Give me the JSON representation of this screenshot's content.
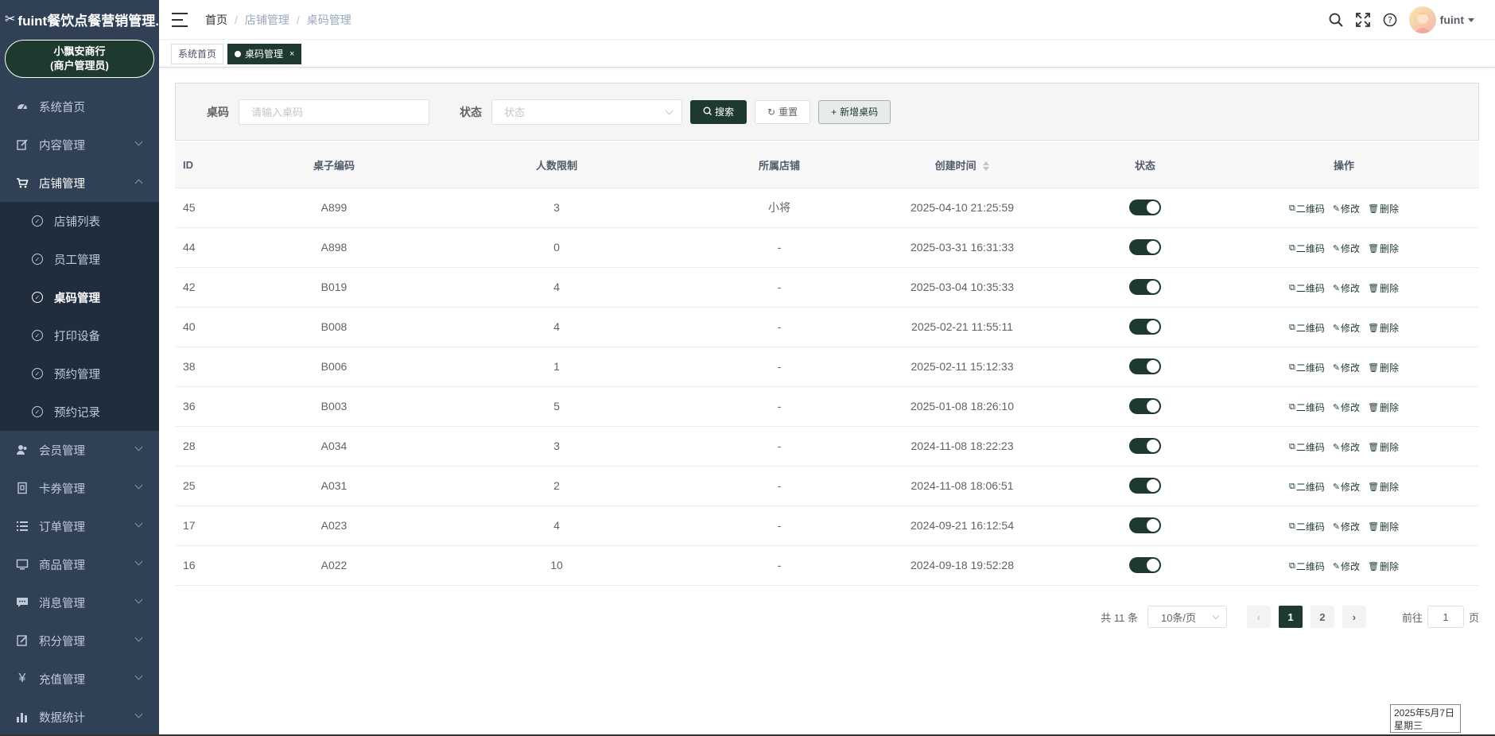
{
  "app": {
    "logo_mark": "✂",
    "title": "fuint餐饮点餐营销管理..."
  },
  "merchant": {
    "name": "小飘安商行",
    "role": "(商户管理员)"
  },
  "sidebar": {
    "items": [
      {
        "label": "系统首页",
        "icon": "dashboard-icon"
      },
      {
        "label": "内容管理",
        "icon": "edit-icon"
      },
      {
        "label": "店铺管理",
        "icon": "cart-icon"
      },
      {
        "label": "会员管理",
        "icon": "user-icon"
      },
      {
        "label": "卡券管理",
        "icon": "coupon-icon"
      },
      {
        "label": "订单管理",
        "icon": "list-icon"
      },
      {
        "label": "商品管理",
        "icon": "goods-icon"
      },
      {
        "label": "消息管理",
        "icon": "message-icon"
      },
      {
        "label": "积分管理",
        "icon": "points-icon"
      },
      {
        "label": "充值管理",
        "icon": "yen-icon"
      },
      {
        "label": "数据统计",
        "icon": "chart-icon"
      }
    ],
    "store_sub": [
      {
        "label": "店铺列表"
      },
      {
        "label": "员工管理"
      },
      {
        "label": "桌码管理"
      },
      {
        "label": "打印设备"
      },
      {
        "label": "预约管理"
      },
      {
        "label": "预约记录"
      }
    ]
  },
  "breadcrumb": {
    "home": "首页",
    "store": "店铺管理",
    "current": "桌码管理",
    "sep": "/"
  },
  "user": {
    "name": "fuint"
  },
  "tags": {
    "home": "系统首页",
    "current": "桌码管理",
    "close": "×"
  },
  "search": {
    "code_label": "桌码",
    "code_placeholder": "请输入桌码",
    "status_label": "状态",
    "status_placeholder": "状态",
    "search_btn": "搜索",
    "reset_btn": "重置",
    "add_btn": "新增桌码"
  },
  "table": {
    "headers": {
      "id": "ID",
      "code": "桌子编码",
      "limit": "人数限制",
      "store": "所属店铺",
      "created": "创建时间",
      "status": "状态",
      "ops": "操作"
    },
    "ops": {
      "qrcode": "二维码",
      "edit": "修改",
      "delete": "删除"
    },
    "rows": [
      {
        "id": "45",
        "code": "A899",
        "limit": "3",
        "store": "小将",
        "created": "2025-04-10 21:25:59"
      },
      {
        "id": "44",
        "code": "A898",
        "limit": "0",
        "store": "-",
        "created": "2025-03-31 16:31:33"
      },
      {
        "id": "42",
        "code": "B019",
        "limit": "4",
        "store": "-",
        "created": "2025-03-04 10:35:33"
      },
      {
        "id": "40",
        "code": "B008",
        "limit": "4",
        "store": "-",
        "created": "2025-02-21 11:55:11"
      },
      {
        "id": "38",
        "code": "B006",
        "limit": "1",
        "store": "-",
        "created": "2025-02-11 15:12:33"
      },
      {
        "id": "36",
        "code": "B003",
        "limit": "5",
        "store": "-",
        "created": "2025-01-08 18:26:10"
      },
      {
        "id": "28",
        "code": "A034",
        "limit": "3",
        "store": "-",
        "created": "2024-11-08 18:22:23"
      },
      {
        "id": "25",
        "code": "A031",
        "limit": "2",
        "store": "-",
        "created": "2024-11-08 18:06:51"
      },
      {
        "id": "17",
        "code": "A023",
        "limit": "4",
        "store": "-",
        "created": "2024-09-21 16:12:54"
      },
      {
        "id": "16",
        "code": "A022",
        "limit": "10",
        "store": "-",
        "created": "2024-09-18 19:52:28"
      }
    ]
  },
  "pagination": {
    "total": "共 11 条",
    "page_size": "10条/页",
    "prev": "‹",
    "next": "›",
    "pages": [
      "1",
      "2"
    ],
    "current": "1",
    "goto_label": "前往",
    "goto_value": "1",
    "page_suffix": "页"
  },
  "datebox": {
    "date": "2025年5月7日",
    "weekday": "星期三"
  },
  "colors": {
    "primary": "#1e3a2f",
    "sidebar": "#304156",
    "submenu": "#1f2d3d"
  }
}
